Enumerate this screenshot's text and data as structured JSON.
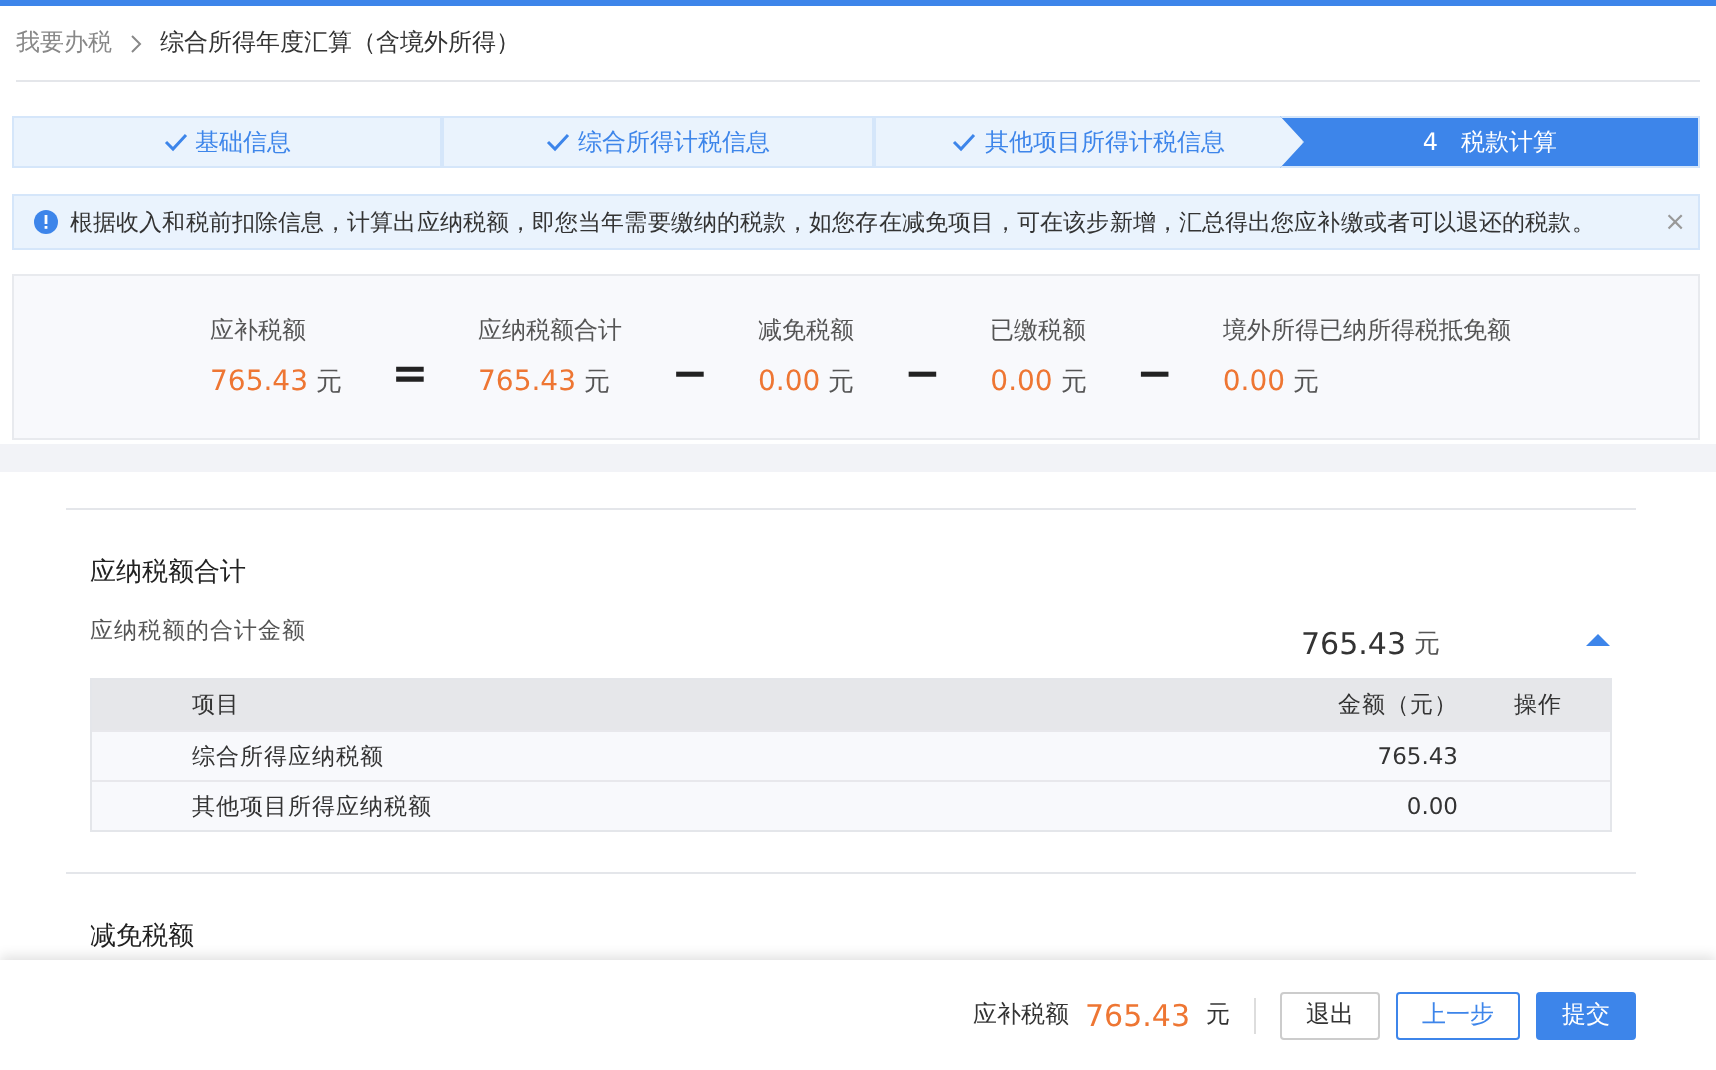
{
  "breadcrumb": [
    {
      "label": "我要办税",
      "current": false
    },
    {
      "label": "综合所得年度汇算（含境外所得）",
      "current": true
    }
  ],
  "steps": [
    {
      "label": "基础信息",
      "done": true,
      "selected": false
    },
    {
      "label": "综合所得计税信息",
      "done": true,
      "selected": false
    },
    {
      "label": "其他项目所得计税信息",
      "done": true,
      "selected": false
    },
    {
      "number": "4",
      "label": "税款计算",
      "done": false,
      "selected": true
    }
  ],
  "notice": {
    "text": "根据收入和税前扣除信息，计算出应纳税额，即您当年需要缴纳的税款，如您存在减免项目，可在该步新增，汇总得出您应补缴或者可以退还的税款。",
    "close": "×"
  },
  "summary": [
    {
      "label": "应补税额",
      "value": "765.43",
      "unit": "元"
    },
    {
      "operator": "=",
      "label": "应纳税额合计",
      "value": "765.43",
      "unit": "元"
    },
    {
      "operator": "−",
      "label": "减免税额",
      "value": "0.00",
      "unit": "元"
    },
    {
      "operator": "−",
      "label": "已缴税额",
      "value": "0.00",
      "unit": "元"
    },
    {
      "operator": "−",
      "label": "境外所得已纳所得税抵免额",
      "value": "0.00",
      "unit": "元"
    }
  ],
  "sections": [
    {
      "title": "应纳税额合计",
      "subtitle": "应纳税额的合计金额",
      "amount": "765.43",
      "unit": "元",
      "expanded": true,
      "table": {
        "columns": [
          "项目",
          "金额（元）",
          "操作"
        ],
        "rows": [
          [
            "综合所得应纳税额",
            "765.43"
          ],
          [
            "其他项目所得应纳税额",
            "0.00"
          ]
        ]
      }
    },
    {
      "title": "减免税额"
    }
  ],
  "footer": {
    "label": "应补税额",
    "value": "765.43",
    "unit": "元",
    "buttons": [
      {
        "label": "退出",
        "kind": "default"
      },
      {
        "label": "上一步",
        "kind": "outline"
      },
      {
        "label": "提交",
        "kind": "primary"
      }
    ]
  }
}
